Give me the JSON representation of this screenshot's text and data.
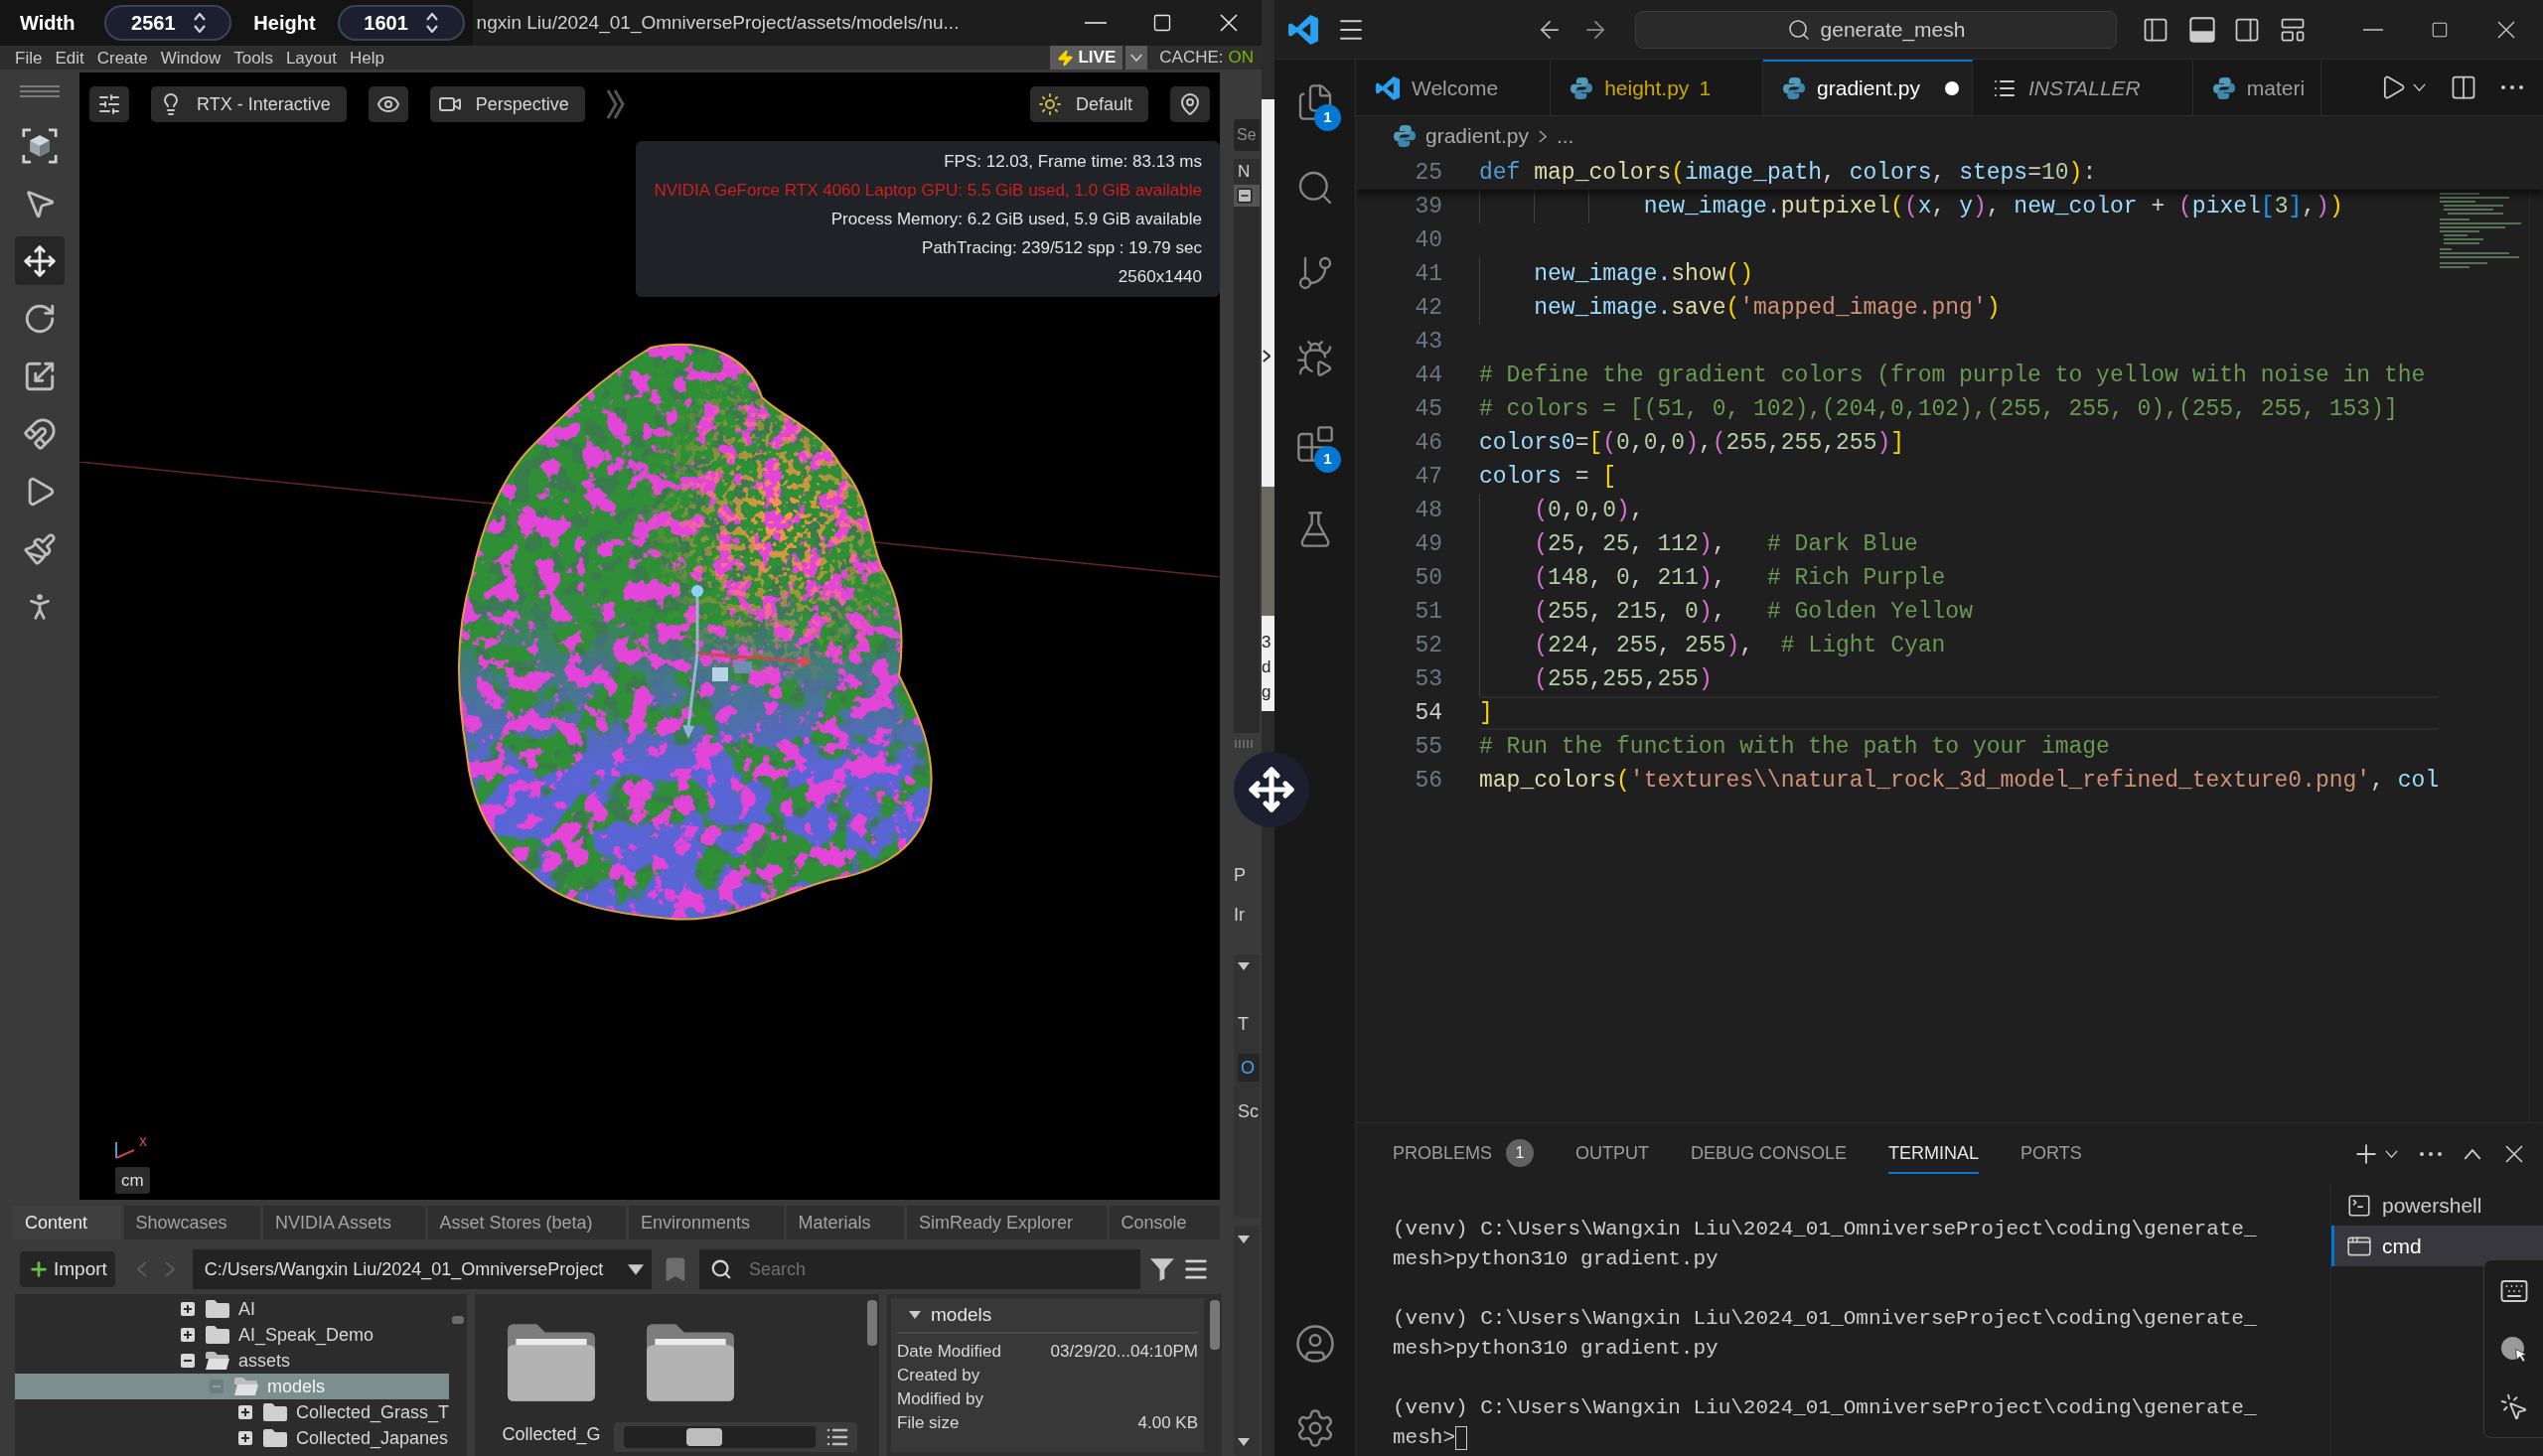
{
  "omniverse": {
    "resolution_overlay": {
      "width_label": "Width",
      "width_value": "2561",
      "height_label": "Height",
      "height_value": "1601"
    },
    "title": "ngxin Liu/2024_01_OmniverseProject/assets/models/nu...",
    "menu": [
      "File",
      "Edit",
      "Create",
      "Window",
      "Tools",
      "Layout",
      "Help"
    ],
    "live_button": "LIVE",
    "cache": {
      "label": "CACHE:",
      "value": "ON"
    },
    "tools": [
      {
        "kind": "frame",
        "selected": false
      },
      {
        "kind": "select",
        "selected": false
      },
      {
        "kind": "move",
        "selected": true
      },
      {
        "kind": "rotate",
        "selected": false
      },
      {
        "kind": "scale",
        "selected": false
      },
      {
        "kind": "snap",
        "selected": false
      },
      {
        "kind": "play",
        "selected": false
      },
      {
        "kind": "paint",
        "selected": false
      },
      {
        "kind": "physics",
        "selected": false
      }
    ],
    "viewport": {
      "toolbar_left": [
        {
          "kind": "settings"
        },
        {
          "kind": "renderer",
          "label": "RTX - Interactive"
        },
        {
          "kind": "visibility"
        },
        {
          "kind": "camera",
          "label": "Perspective"
        },
        {
          "kind": "more"
        }
      ],
      "toolbar_right": [
        {
          "kind": "lighting",
          "label": "Default"
        },
        {
          "kind": "pin"
        }
      ],
      "stats": [
        {
          "text": "FPS: 12.03, Frame time: 83.13 ms",
          "kind": "normal"
        },
        {
          "text": "NVIDIA GeForce RTX 4060 Laptop GPU: 5.5 GiB used, 1.0 GiB available",
          "kind": "warning"
        },
        {
          "text": "Process Memory: 6.2 GiB used, 5.9 GiB available",
          "kind": "normal"
        },
        {
          "text": "PathTracing: 239/512 spp : 19.79 sec",
          "kind": "normal"
        },
        {
          "text": "2560x1440",
          "kind": "normal"
        }
      ],
      "axis_label": "x",
      "units": "cm"
    },
    "property_panel": {
      "search_placeholder": "Se",
      "column_header": "N",
      "labels": [
        "P",
        "Ir"
      ],
      "section": [
        {
          "text": "T",
          "kind": "label"
        },
        {
          "text": "O",
          "kind": "value"
        },
        {
          "text": "Sc",
          "kind": "label"
        }
      ]
    },
    "background_window": {
      "letters": [
        "3",
        "d",
        "g"
      ]
    },
    "content_browser": {
      "tabs": [
        {
          "label": "Content",
          "selected": true
        },
        {
          "label": "Showcases",
          "selected": false
        },
        {
          "label": "NVIDIA Assets",
          "selected": false
        },
        {
          "label": "Asset Stores (beta)",
          "selected": false
        },
        {
          "label": "Environments",
          "selected": false
        },
        {
          "label": "Materials",
          "selected": false
        },
        {
          "label": "SimReady Explorer",
          "selected": false
        },
        {
          "label": "Console",
          "selected": false
        }
      ],
      "import_button": "Import",
      "path": "C:/Users/Wangxin Liu/2024_01_OmniverseProject",
      "search_placeholder": "Search",
      "tree": [
        {
          "label": "AI",
          "expanded": false,
          "selected": false
        },
        {
          "label": "AI_Speak_Demo",
          "expanded": false,
          "selected": false
        },
        {
          "label": "assets",
          "expanded": true,
          "selected": false,
          "children": [
            {
              "label": "models",
              "expanded": true,
              "selected": true,
              "children": [
                {
                  "label": "Collected_Grass_T",
                  "expanded": false,
                  "selected": false
                },
                {
                  "label": "Collected_Japanes",
                  "expanded": false,
                  "selected": false
                }
              ]
            }
          ]
        }
      ],
      "folders": [
        {
          "kind": "folder",
          "name": "Collected_G"
        },
        {
          "kind": "folder"
        }
      ],
      "thumbnail_slider": {
        "level": 0.4
      },
      "details": {
        "title": "models",
        "rows": [
          {
            "label": "Date Modified",
            "value": "03/29/20...04:10PM"
          },
          {
            "label": "Created by"
          },
          {
            "label": "Modified by"
          },
          {
            "label": "File size",
            "value": "4.00 KB"
          }
        ]
      }
    }
  },
  "vscode": {
    "command_center": "generate_mesh",
    "activity": [
      {
        "kind": "explorer",
        "badge": "1"
      },
      {
        "kind": "search"
      },
      {
        "kind": "source-control"
      },
      {
        "kind": "run-debug"
      },
      {
        "kind": "extensions",
        "badge": "1"
      },
      {
        "kind": "testing"
      }
    ],
    "activity_bottom": [
      {
        "kind": "account"
      },
      {
        "kind": "settings"
      }
    ],
    "tabs": [
      {
        "label": "Welcome",
        "kind": "welcome",
        "selected": false,
        "modified": false,
        "warning": false,
        "preview": false
      },
      {
        "label": "height.py",
        "problems": "1",
        "kind": "python",
        "selected": false,
        "modified": false,
        "warning": true,
        "preview": false
      },
      {
        "label": "gradient.py",
        "kind": "python",
        "selected": true,
        "modified": true,
        "warning": false,
        "preview": false
      },
      {
        "label": "INSTALLER",
        "kind": "text",
        "selected": false,
        "modified": false,
        "warning": false,
        "preview": true
      },
      {
        "label": "materi",
        "kind": "python",
        "selected": false,
        "modified": false,
        "warning": false,
        "preview": false
      }
    ],
    "breadcrumb": {
      "file": "gradient.py",
      "symbol": "..."
    },
    "code": {
      "sticky": {
        "number": "25",
        "current": false,
        "tokens": [
          {
            "text": "def",
            "kind": "keyword"
          },
          {
            "text": " map_colors",
            "kind": "function"
          },
          {
            "text": "(",
            "kind": "bracket1"
          },
          {
            "text": "image_path",
            "kind": "variable"
          },
          {
            "text": ", ",
            "kind": "plain"
          },
          {
            "text": "colors",
            "kind": "variable"
          },
          {
            "text": ", ",
            "kind": "plain"
          },
          {
            "text": "steps",
            "kind": "variable"
          },
          {
            "text": "=",
            "kind": "plain"
          },
          {
            "text": "10",
            "kind": "number"
          },
          {
            "text": ")",
            "kind": "bracket1"
          },
          {
            "text": ":",
            "kind": "plain"
          }
        ]
      },
      "lines": [
        {
          "number": "39",
          "current": false,
          "tokens": [
            {
              "text": "            new_image.",
              "kind": "variable"
            },
            {
              "text": "putpixel",
              "kind": "function"
            },
            {
              "text": "(",
              "kind": "bracket1"
            },
            {
              "text": "(",
              "kind": "bracket2"
            },
            {
              "text": "x",
              "kind": "variable"
            },
            {
              "text": ", ",
              "kind": "plain"
            },
            {
              "text": "y",
              "kind": "variable"
            },
            {
              "text": ")",
              "kind": "bracket2"
            },
            {
              "text": ", ",
              "kind": "plain"
            },
            {
              "text": "new_color",
              "kind": "variable"
            },
            {
              "text": " + ",
              "kind": "plain"
            },
            {
              "text": "(",
              "kind": "bracket2"
            },
            {
              "text": "pixel",
              "kind": "variable"
            },
            {
              "text": "[",
              "kind": "bracket3"
            },
            {
              "text": "3",
              "kind": "number"
            },
            {
              "text": "]",
              "kind": "bracket3"
            },
            {
              "text": ",",
              "kind": "plain"
            },
            {
              "text": ")",
              "kind": "bracket2"
            },
            {
              "text": ")",
              "kind": "bracket1"
            }
          ]
        },
        {
          "number": "40",
          "current": false
        },
        {
          "number": "41",
          "current": false,
          "tokens": [
            {
              "text": "    new_image.",
              "kind": "variable"
            },
            {
              "text": "show",
              "kind": "function"
            },
            {
              "text": "(",
              "kind": "bracket1"
            },
            {
              "text": ")",
              "kind": "bracket1"
            }
          ]
        },
        {
          "number": "42",
          "current": false,
          "tokens": [
            {
              "text": "    new_image.",
              "kind": "variable"
            },
            {
              "text": "save",
              "kind": "function"
            },
            {
              "text": "(",
              "kind": "bracket1"
            },
            {
              "text": "'mapped_image.png'",
              "kind": "string"
            },
            {
              "text": ")",
              "kind": "bracket1"
            }
          ]
        },
        {
          "number": "43",
          "current": false
        },
        {
          "number": "44",
          "current": false,
          "tokens": [
            {
              "text": "# Define the gradient colors (from purple to yellow with noise in the",
              "kind": "comment"
            }
          ]
        },
        {
          "number": "45",
          "current": false,
          "tokens": [
            {
              "text": "# colors = [(51, 0, 102),(204,0,102),(255, 255, 0),(255, 255, 153)]",
              "kind": "comment"
            }
          ]
        },
        {
          "number": "46",
          "current": false,
          "tokens": [
            {
              "text": "colors0",
              "kind": "variable"
            },
            {
              "text": "=",
              "kind": "plain"
            },
            {
              "text": "[",
              "kind": "bracket1"
            },
            {
              "text": "(",
              "kind": "bracket2"
            },
            {
              "text": "0",
              "kind": "number"
            },
            {
              "text": ",",
              "kind": "plain"
            },
            {
              "text": "0",
              "kind": "number"
            },
            {
              "text": ",",
              "kind": "plain"
            },
            {
              "text": "0",
              "kind": "number"
            },
            {
              "text": ")",
              "kind": "bracket2"
            },
            {
              "text": ",",
              "kind": "plain"
            },
            {
              "text": "(",
              "kind": "bracket2"
            },
            {
              "text": "255",
              "kind": "number"
            },
            {
              "text": ",",
              "kind": "plain"
            },
            {
              "text": "255",
              "kind": "number"
            },
            {
              "text": ",",
              "kind": "plain"
            },
            {
              "text": "255",
              "kind": "number"
            },
            {
              "text": ")",
              "kind": "bracket2"
            },
            {
              "text": "]",
              "kind": "bracket1"
            }
          ]
        },
        {
          "number": "47",
          "current": false,
          "tokens": [
            {
              "text": "colors",
              "kind": "variable"
            },
            {
              "text": " = ",
              "kind": "plain"
            },
            {
              "text": "[",
              "kind": "bracket1"
            }
          ]
        },
        {
          "number": "48",
          "current": false,
          "tokens": [
            {
              "text": "    (",
              "kind": "bracket2"
            },
            {
              "text": "0",
              "kind": "number"
            },
            {
              "text": ",",
              "kind": "plain"
            },
            {
              "text": "0",
              "kind": "number"
            },
            {
              "text": ",",
              "kind": "plain"
            },
            {
              "text": "0",
              "kind": "number"
            },
            {
              "text": ")",
              "kind": "bracket2"
            },
            {
              "text": ",",
              "kind": "plain"
            }
          ]
        },
        {
          "number": "49",
          "current": false,
          "tokens": [
            {
              "text": "    (",
              "kind": "bracket2"
            },
            {
              "text": "25",
              "kind": "number"
            },
            {
              "text": ", ",
              "kind": "plain"
            },
            {
              "text": "25",
              "kind": "number"
            },
            {
              "text": ", ",
              "kind": "plain"
            },
            {
              "text": "112",
              "kind": "number"
            },
            {
              "text": ")",
              "kind": "bracket2"
            },
            {
              "text": ",   ",
              "kind": "plain"
            },
            {
              "text": "# Dark Blue",
              "kind": "comment"
            }
          ]
        },
        {
          "number": "50",
          "current": false,
          "tokens": [
            {
              "text": "    (",
              "kind": "bracket2"
            },
            {
              "text": "148",
              "kind": "number"
            },
            {
              "text": ", ",
              "kind": "plain"
            },
            {
              "text": "0",
              "kind": "number"
            },
            {
              "text": ", ",
              "kind": "plain"
            },
            {
              "text": "211",
              "kind": "number"
            },
            {
              "text": ")",
              "kind": "bracket2"
            },
            {
              "text": ",   ",
              "kind": "plain"
            },
            {
              "text": "# Rich Purple",
              "kind": "comment"
            }
          ]
        },
        {
          "number": "51",
          "current": false,
          "tokens": [
            {
              "text": "    (",
              "kind": "bracket2"
            },
            {
              "text": "255",
              "kind": "number"
            },
            {
              "text": ", ",
              "kind": "plain"
            },
            {
              "text": "215",
              "kind": "number"
            },
            {
              "text": ", ",
              "kind": "plain"
            },
            {
              "text": "0",
              "kind": "number"
            },
            {
              "text": ")",
              "kind": "bracket2"
            },
            {
              "text": ",   ",
              "kind": "plain"
            },
            {
              "text": "# Golden Yellow",
              "kind": "comment"
            }
          ]
        },
        {
          "number": "52",
          "current": false,
          "tokens": [
            {
              "text": "    (",
              "kind": "bracket2"
            },
            {
              "text": "224",
              "kind": "number"
            },
            {
              "text": ", ",
              "kind": "plain"
            },
            {
              "text": "255",
              "kind": "number"
            },
            {
              "text": ", ",
              "kind": "plain"
            },
            {
              "text": "255",
              "kind": "number"
            },
            {
              "text": ")",
              "kind": "bracket2"
            },
            {
              "text": ",  ",
              "kind": "plain"
            },
            {
              "text": "# Light Cyan",
              "kind": "comment"
            }
          ]
        },
        {
          "number": "53",
          "current": false,
          "tokens": [
            {
              "text": "    (",
              "kind": "bracket2"
            },
            {
              "text": "255",
              "kind": "number"
            },
            {
              "text": ",",
              "kind": "plain"
            },
            {
              "text": "255",
              "kind": "number"
            },
            {
              "text": ",",
              "kind": "plain"
            },
            {
              "text": "255",
              "kind": "number"
            },
            {
              "text": ")",
              "kind": "bracket2"
            }
          ]
        },
        {
          "number": "54",
          "current": true,
          "tokens": [
            {
              "text": "]",
              "kind": "bracket1"
            }
          ]
        },
        {
          "number": "55",
          "current": false,
          "tokens": [
            {
              "text": "# Run the function with the path to your image",
              "kind": "comment"
            }
          ]
        },
        {
          "number": "56",
          "current": false,
          "tokens": [
            {
              "text": "map_colors",
              "kind": "function"
            },
            {
              "text": "(",
              "kind": "bracket1"
            },
            {
              "text": "'textures\\\\natural_rock_3d_model_refined_texture0.png'",
              "kind": "string"
            },
            {
              "text": ", ",
              "kind": "plain"
            },
            {
              "text": "col",
              "kind": "variable"
            }
          ]
        }
      ]
    },
    "panel": {
      "tabs": [
        {
          "label": "PROBLEMS",
          "badge": "1",
          "selected": false
        },
        {
          "label": "OUTPUT",
          "selected": false
        },
        {
          "label": "DEBUG CONSOLE",
          "selected": false
        },
        {
          "label": "TERMINAL",
          "selected": true
        },
        {
          "label": "PORTS",
          "selected": false
        }
      ],
      "terminal": [
        {
          "lines": [
            "(venv) C:\\Users\\Wangxin Liu\\2024_01_OmniverseProject\\coding\\generate_",
            "mesh>python310 gradient.py"
          ],
          "cursor": false
        },
        {
          "lines": [
            "(venv) C:\\Users\\Wangxin Liu\\2024_01_OmniverseProject\\coding\\generate_",
            "mesh>python310 gradient.py"
          ],
          "cursor": false
        },
        {
          "lines": [
            "(venv) C:\\Users\\Wangxin Liu\\2024_01_OmniverseProject\\coding\\generate_",
            "mesh>"
          ],
          "cursor": true
        }
      ],
      "terminals": [
        {
          "label": "powershell",
          "kind": "powershell",
          "selected": false
        },
        {
          "label": "cmd",
          "kind": "cmd",
          "selected": true
        }
      ]
    }
  }
}
